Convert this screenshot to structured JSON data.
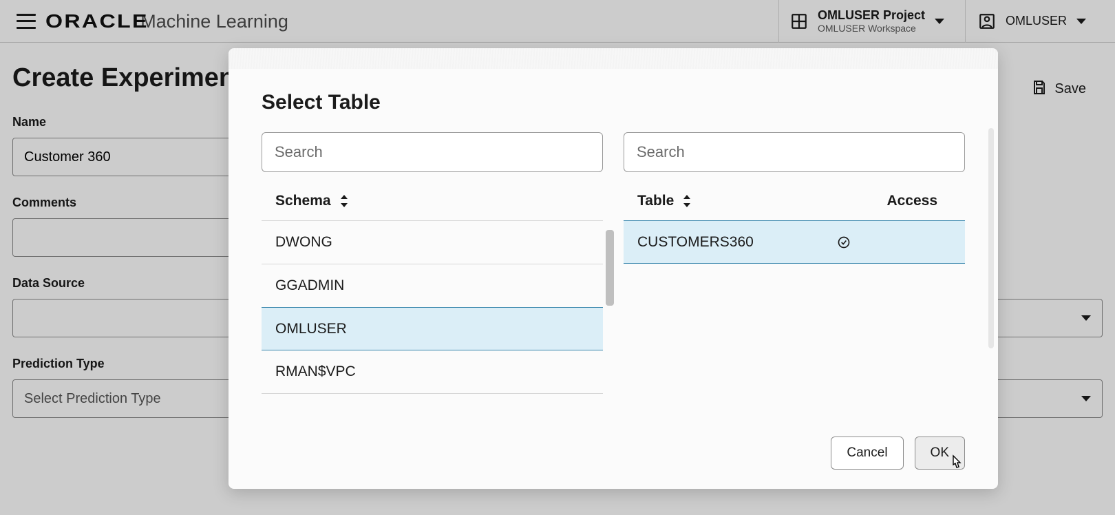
{
  "header": {
    "brand_logo": "ORACLE",
    "brand_sub": "Machine Learning",
    "project_title": "OMLUSER Project",
    "project_sub": "OMLUSER Workspace",
    "user_name": "OMLUSER"
  },
  "page": {
    "title": "Create Experiment",
    "save_label": "Save",
    "fields": {
      "name_label": "Name",
      "name_value": "Customer 360",
      "comments_label": "Comments",
      "comments_value": "",
      "data_source_label": "Data Source",
      "data_source_value": "",
      "prediction_type_label": "Prediction Type",
      "prediction_type_placeholder": "Select Prediction Type"
    }
  },
  "modal": {
    "title": "Select Table",
    "search_placeholder_left": "Search",
    "search_placeholder_right": "Search",
    "schema_header": "Schema",
    "table_header": "Table",
    "access_header": "Access",
    "schemas": [
      "DWONG",
      "GGADMIN",
      "OMLUSER",
      "RMAN$VPC"
    ],
    "selected_schema_index": 2,
    "tables": [
      {
        "name": "CUSTOMERS360",
        "access": true
      }
    ],
    "selected_table_index": 0,
    "cancel_label": "Cancel",
    "ok_label": "OK"
  }
}
